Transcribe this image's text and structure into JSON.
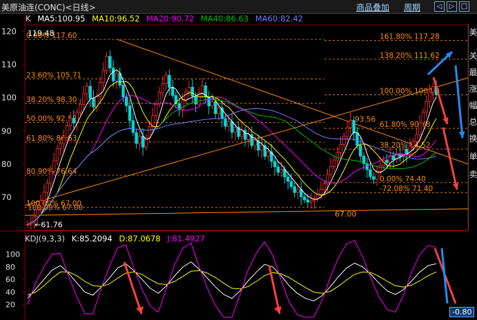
{
  "window": {
    "title": "美原油连(CONC)<日线>",
    "btn_overlay": "商品叠加",
    "btn_period": "周期",
    "win_controls": [
      "◁",
      "▷",
      "□"
    ]
  },
  "ma_legend": {
    "k": "K",
    "ma5": "MA5:100.95",
    "ma10": "MA10:96.52",
    "ma20": "MA20:90.72",
    "ma40": "MA40:86.63",
    "ma60": "MA60:82.42"
  },
  "kdj_legend": {
    "label": "KDJ(9,3,3)",
    "k": "K:85.2094",
    "d": "D:87.0678",
    "j": "J:81.4927"
  },
  "side_text": [
    "美",
    "关",
    "最",
    "涨",
    "幅",
    "总",
    "换",
    "单",
    "卖"
  ],
  "readout": "-0.80",
  "colors": {
    "up": "#ff3030",
    "down": "#00d8d8",
    "ma5": "#ffffff",
    "ma10": "#ffff00",
    "ma20": "#ff00ff",
    "ma40": "#00c000",
    "ma60": "#7878ff",
    "fib": "#ff8c00",
    "arrow_red": "#ff4040",
    "arrow_blue": "#1e90ff"
  },
  "chart_data": [
    {
      "type": "candlestick",
      "title": "美原油连(CONC)<日线>",
      "ylim": [
        60,
        122
      ],
      "y_ticks": [
        70,
        80,
        90,
        100,
        110,
        120
      ],
      "annotations": {
        "high_label": "119.48",
        "low_label": "61.76",
        "low2_label": "67.00",
        "left_low_label": "67.00"
      },
      "close": [
        61.8,
        62.5,
        64.1,
        66.2,
        69.0,
        71.5,
        74.2,
        77.8,
        81.0,
        84.6,
        86.2,
        88.0,
        91.5,
        93.8,
        92.4,
        95.6,
        98.0,
        101.2,
        103.5,
        99.8,
        97.2,
        100.4,
        104.6,
        108.2,
        112.5,
        109.0,
        105.1,
        107.4,
        103.8,
        100.2,
        97.6,
        93.1,
        89.5,
        86.2,
        88.4,
        85.1,
        87.9,
        91.3,
        94.6,
        98.1,
        101.5,
        104.2,
        106.8,
        103.1,
        100.7,
        98.2,
        96.4,
        99.1,
        101.8,
        103.2,
        100.5,
        98.1,
        101.4,
        103.6,
        100.2,
        97.5,
        98.8,
        95.2,
        96.9,
        93.7,
        91.4,
        92.8,
        89.6,
        91.1,
        88.3,
        90.2,
        87.4,
        88.9,
        85.6,
        87.1,
        84.2,
        85.6,
        82.3,
        83.7,
        80.8,
        79.2,
        77.5,
        78.4,
        76.1,
        74.8,
        73.2,
        71.4,
        72.3,
        70.1,
        69.2,
        68.5,
        68.9,
        69.6,
        70.8,
        72.4,
        74.1,
        76.8,
        79.3,
        81.2,
        83.5,
        85.9,
        88.4,
        91.0,
        93.2,
        89.4,
        85.6,
        82.4,
        80.1,
        78.3,
        76.2,
        75.4,
        77.8,
        79.5,
        81.2,
        80.4,
        82.6,
        81.3,
        83.1,
        82.2,
        84.5,
        83.0,
        85.4,
        86.8,
        88.9,
        92.4,
        95.6,
        98.8,
        101.7,
        103.4,
        100.95
      ],
      "ma": {
        "MA5": 100.95,
        "MA10": 96.52,
        "MA20": 90.72,
        "MA40": 86.63,
        "MA60": 82.42
      },
      "fibonacci_left": [
        {
          "label": "0.00%",
          "value": 117.6
        },
        {
          "label": "23.60%",
          "value": 105.71
        },
        {
          "label": "38.20%",
          "value": 98.3
        },
        {
          "label": "50.00%",
          "value": 92.58
        },
        {
          "label": "61.80%",
          "value": 86.63
        },
        {
          "label": "80.90%",
          "value": 76.64
        },
        {
          "label": "100.00%",
          "value": 67.0
        }
      ],
      "fibonacci_right": [
        {
          "label": "161.80%",
          "value": 117.28
        },
        {
          "label": "138.20%",
          "value": 111.62
        },
        {
          "label": "100.00%",
          "value": 100.9
        },
        {
          "label": "61.80%",
          "value": 90.78
        },
        {
          "label": "38.20%",
          "value": 84.52
        },
        {
          "label": "-72.08%",
          "value": 71.4
        },
        {
          "label": "0.00%",
          "value": 74.4
        }
      ],
      "extra_labels": [
        "93.56",
        "67.00"
      ]
    },
    {
      "type": "line",
      "title": "KDJ(9,3,3)",
      "ylim": [
        0,
        115
      ],
      "y_ticks": [
        20,
        40,
        60,
        80,
        100
      ],
      "series": [
        {
          "name": "K",
          "values": [
            30,
            45,
            60,
            75,
            82,
            70,
            55,
            40,
            35,
            48,
            62,
            78,
            85,
            74,
            60,
            46,
            38,
            50,
            66,
            80,
            88,
            76,
            62,
            48,
            36,
            30,
            42,
            58,
            72,
            84,
            80,
            66,
            50,
            38,
            30,
            26,
            34,
            48,
            64,
            78,
            86,
            80,
            68,
            54,
            42,
            36,
            44,
            58,
            72,
            82,
            85
          ]
        },
        {
          "name": "D",
          "values": [
            35,
            40,
            50,
            62,
            72,
            72,
            66,
            57,
            50,
            49,
            53,
            62,
            70,
            72,
            68,
            60,
            53,
            52,
            57,
            65,
            73,
            74,
            70,
            63,
            54,
            46,
            45,
            49,
            57,
            66,
            71,
            69,
            63,
            55,
            47,
            40,
            38,
            41,
            49,
            59,
            68,
            72,
            71,
            65,
            57,
            50,
            48,
            51,
            58,
            66,
            72
          ]
        },
        {
          "name": "J",
          "values": [
            20,
            55,
            80,
            100,
            102,
            66,
            33,
            6,
            5,
            46,
            80,
            110,
            115,
            78,
            44,
            18,
            8,
            46,
            84,
            110,
            118,
            80,
            46,
            18,
            0,
            0,
            36,
            76,
            102,
            120,
            98,
            60,
            24,
            4,
            0,
            0,
            26,
            62,
            94,
            116,
            122,
            96,
            62,
            32,
            12,
            8,
            36,
            72,
            100,
            114,
            111
          ]
        }
      ]
    }
  ]
}
